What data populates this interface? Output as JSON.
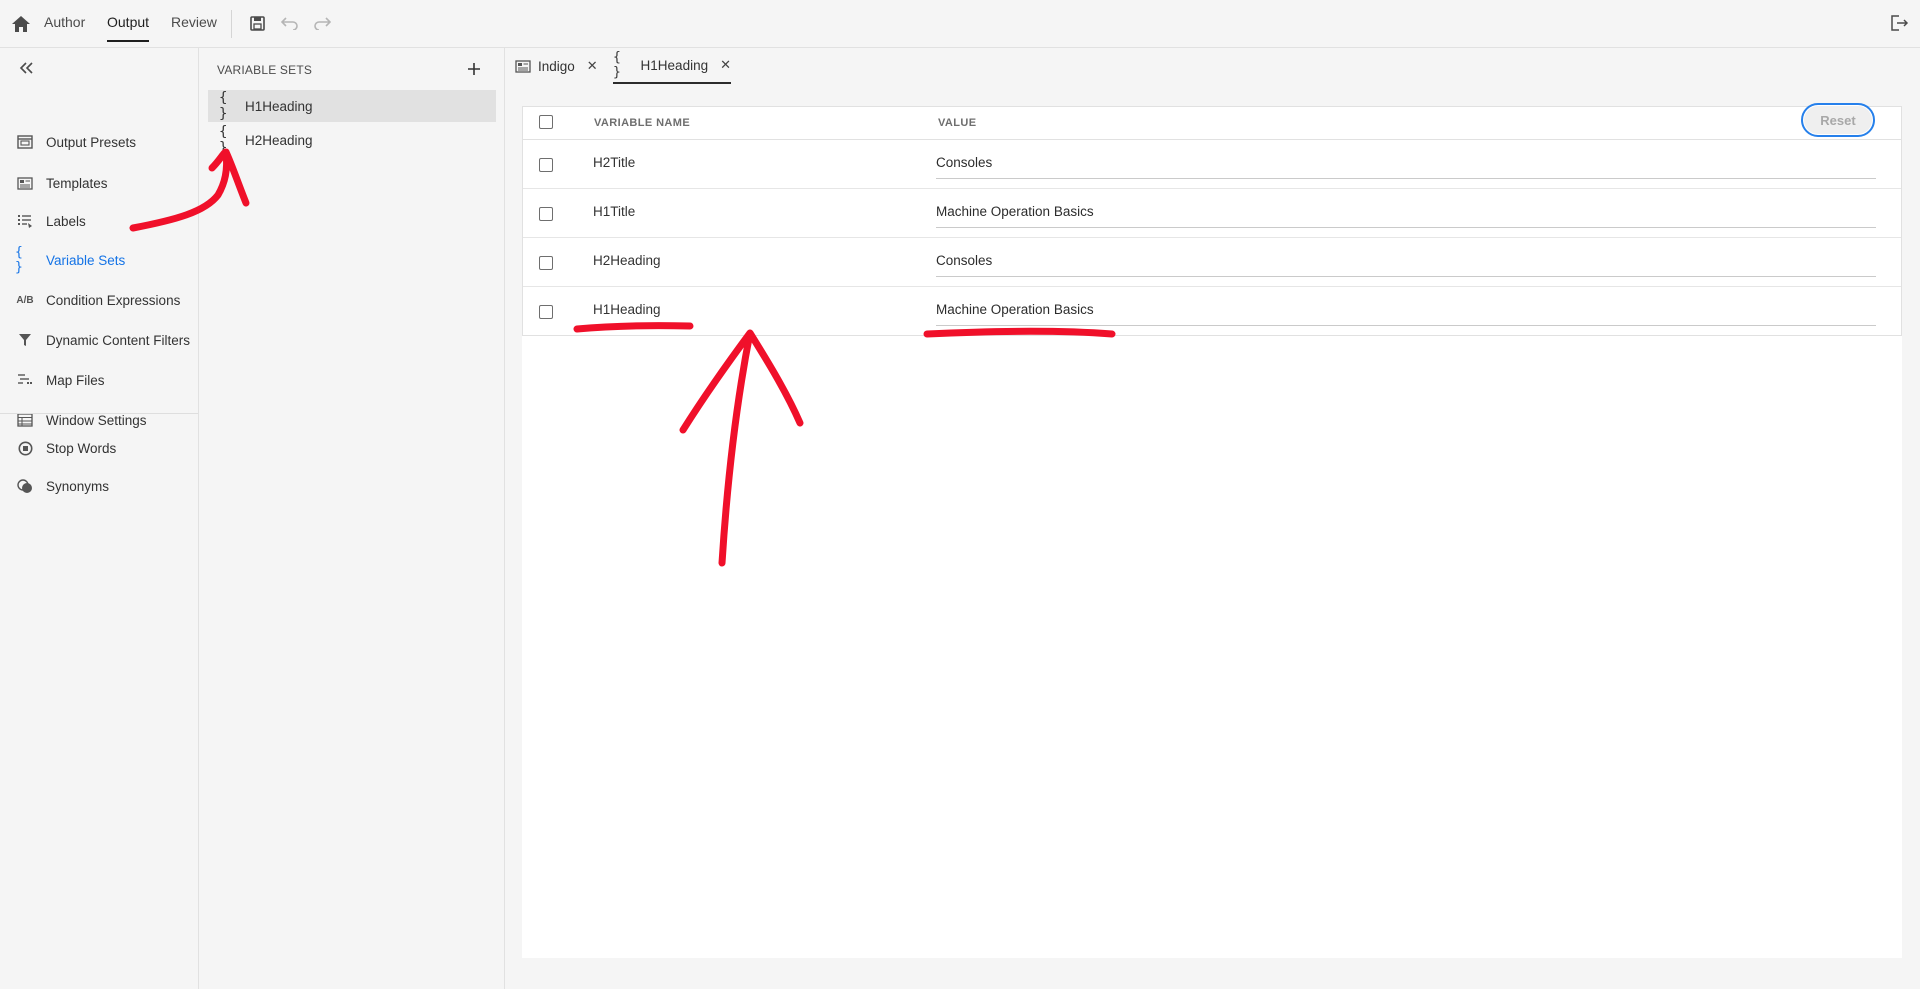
{
  "topbar": {
    "tabs": [
      {
        "label": "Author"
      },
      {
        "label": "Output"
      },
      {
        "label": "Review"
      }
    ],
    "icons": [
      "home-icon",
      "save-icon",
      "undo-icon",
      "redo-icon",
      "exit-icon"
    ]
  },
  "leftnav": {
    "items": [
      {
        "label": "Output Presets",
        "icon": "output-presets-icon"
      },
      {
        "label": "Templates",
        "icon": "templates-icon"
      },
      {
        "label": "Labels",
        "icon": "labels-icon"
      },
      {
        "label": "Variable Sets",
        "icon": "variable-sets-icon",
        "glyph": "{ }"
      },
      {
        "label": "Condition Expressions",
        "icon": "condition-expressions-icon",
        "glyph": "A/B"
      },
      {
        "label": "Dynamic Content Filters",
        "icon": "filter-icon"
      },
      {
        "label": "Map Files",
        "icon": "map-files-icon"
      },
      {
        "label": "Window Settings",
        "icon": "window-settings-icon"
      },
      {
        "label": "Stop Words",
        "icon": "stop-words-icon"
      },
      {
        "label": "Synonyms",
        "icon": "synonyms-icon"
      }
    ],
    "active_color": "#1473e6"
  },
  "variable_sets_panel": {
    "title": "VARIABLE SETS",
    "items": [
      {
        "label": "H1Heading",
        "glyph": "{ }"
      },
      {
        "label": "H2Heading",
        "glyph": "{ }"
      }
    ]
  },
  "doc_tabs": [
    {
      "label": "Indigo",
      "close": "✕"
    },
    {
      "label": "H1Heading",
      "glyph": "{ }",
      "close": "✕"
    }
  ],
  "table": {
    "headers": {
      "name": "VARIABLE NAME",
      "value": "VALUE"
    },
    "reset_label": "Reset",
    "rows": [
      {
        "name": "H2Title",
        "value": "Consoles"
      },
      {
        "name": "H1Title",
        "value": "Machine Operation Basics"
      },
      {
        "name": "H2Heading",
        "value": "Consoles"
      },
      {
        "name": "H1Heading",
        "value": "Machine Operation Basics"
      }
    ]
  },
  "annotation_color": "#f0102a"
}
